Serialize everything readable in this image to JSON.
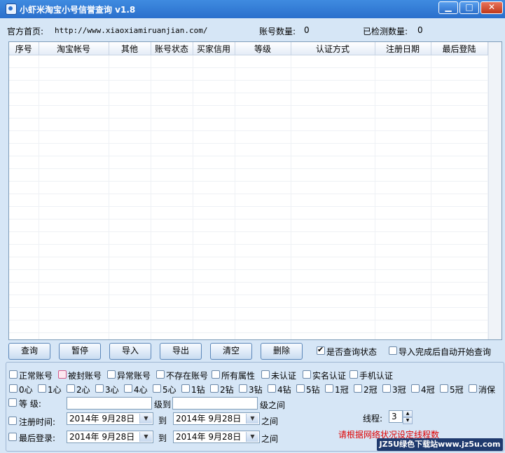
{
  "window": {
    "title": "小虾米淘宝小号信誉查询 v1.8",
    "min": "▁",
    "max": "□",
    "close": "✕"
  },
  "header": {
    "home_label": "官方首页:",
    "home_url": "http://www.xiaoxiamiruanjian.com/",
    "account_count_label": "账号数量:",
    "account_count": "0",
    "checked_count_label": "已检测数量:",
    "checked_count": "0"
  },
  "table": {
    "columns": [
      "序号",
      "淘宝帐号",
      "其他",
      "账号状态",
      "买家信用",
      "等级",
      "认证方式",
      "注册日期",
      "最后登陆"
    ]
  },
  "buttons": {
    "query": "查询",
    "pause": "暂停",
    "import": "导入",
    "export": "导出",
    "clear": "清空",
    "delete": "删除"
  },
  "options": {
    "query_status": "是否查询状态",
    "auto_start": "导入完成后自动开始查询"
  },
  "filters_row1": [
    "正常账号",
    "被封账号",
    "异常账号",
    "不存在账号",
    "所有属性",
    "未认证",
    "实名认证",
    "手机认证"
  ],
  "filters_row2": [
    "0心",
    "1心",
    "2心",
    "3心",
    "4心",
    "5心",
    "1钻",
    "2钻",
    "3钻",
    "4钻",
    "5钻",
    "1冠",
    "2冠",
    "3冠",
    "4冠",
    "5冠",
    "消保"
  ],
  "level": {
    "label": "等    级:",
    "to": "级到",
    "between": "级之间"
  },
  "reg_time": {
    "label": "注册时间:",
    "from": "2014年  9月28日",
    "to_label": "到",
    "to": "2014年  9月28日",
    "between": "之间"
  },
  "last_login": {
    "label": "最后登录:",
    "from": "2014年  9月28日",
    "to_label": "到",
    "to": "2014年  9月28日",
    "between": "之间"
  },
  "threads": {
    "label": "线程:",
    "value": "3"
  },
  "hint": "请根据网络状况设定线程数",
  "watermark": "JZ5U绿色下载站www.jz5u.com"
}
